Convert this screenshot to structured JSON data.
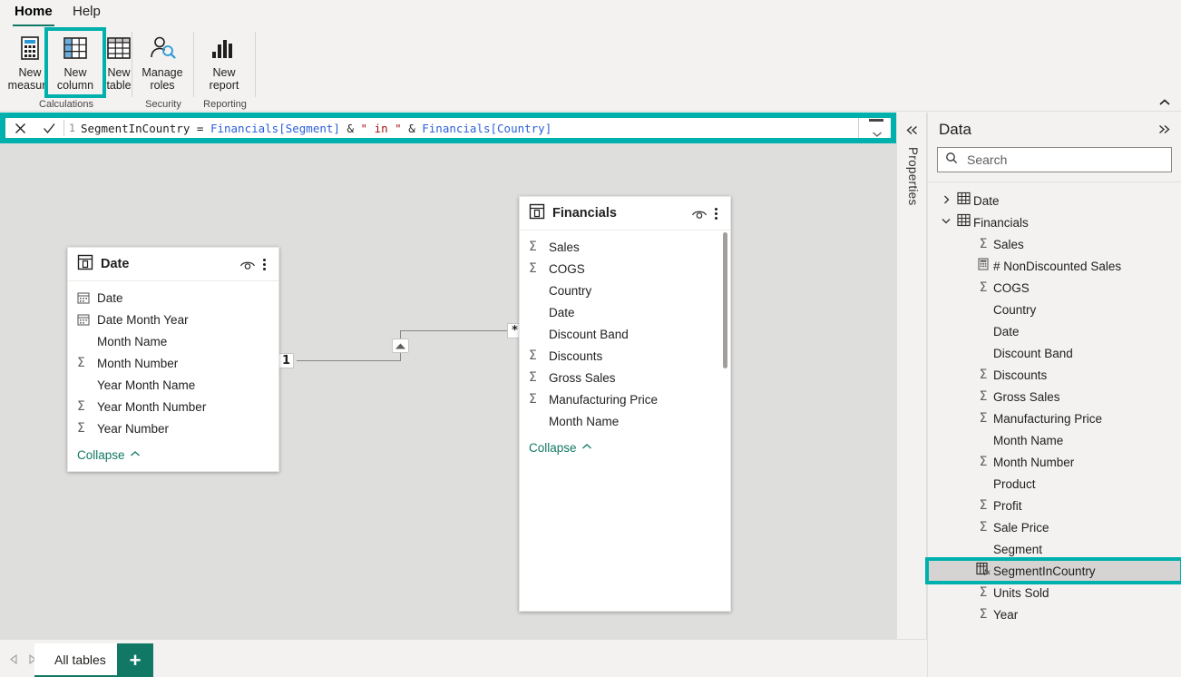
{
  "ribbon": {
    "tabs": [
      {
        "label": "Home",
        "active": true
      },
      {
        "label": "Help",
        "active": false
      }
    ],
    "groups": [
      {
        "label": "Calculations"
      },
      {
        "label": "Security"
      },
      {
        "label": "Reporting"
      }
    ],
    "buttons": [
      {
        "line1": "New",
        "line2": "measure",
        "icon": "new-measure-icon",
        "selected": false
      },
      {
        "line1": "New",
        "line2": "column",
        "icon": "new-column-icon",
        "selected": true
      },
      {
        "line1": "New",
        "line2": "table",
        "icon": "new-table-icon",
        "selected": false
      },
      {
        "line1": "Manage",
        "line2": "roles",
        "icon": "manage-roles-icon",
        "selected": false
      },
      {
        "line1": "New",
        "line2": "report",
        "icon": "new-report-icon",
        "selected": false
      }
    ],
    "collapse_icon": "chevron-up-icon"
  },
  "formula_bar": {
    "cancel_icon": "close-icon",
    "commit_icon": "checkmark-icon",
    "line_number": "1",
    "expression": "SegmentInCountry = Financials[Segment] & \" in \" & Financials[Country]",
    "tokens": {
      "name": "SegmentInCountry ",
      "equals": "= ",
      "ref1": "Financials[Segment]",
      "amp1": " & ",
      "string": "\" in \"",
      "amp2": " & ",
      "ref2": "Financials[Country]"
    },
    "expand_icon": "chevron-down-icon",
    "accent_color": "#00b0ad"
  },
  "properties_rail": {
    "label": "Properties",
    "collapse_icon": "chevron-double-left-icon"
  },
  "canvas": {
    "tables": [
      {
        "name": "Date",
        "icon": "table-card-icon",
        "eye_icon": "hide-eye-icon",
        "more_icon": "more-options-icon",
        "collapse_label": "Collapse",
        "collapse_icon": "chevron-up-icon",
        "fields": [
          {
            "name": "Date",
            "icon": "calendar-icon"
          },
          {
            "name": "Date Month Year",
            "icon": "calendar-icon"
          },
          {
            "name": "Month Name",
            "icon": "none"
          },
          {
            "name": "Month Number",
            "icon": "sigma-icon"
          },
          {
            "name": "Year Month Name",
            "icon": "none"
          },
          {
            "name": "Year Month Number",
            "icon": "sigma-icon"
          },
          {
            "name": "Year Number",
            "icon": "sigma-icon"
          }
        ]
      },
      {
        "name": "Financials",
        "icon": "table-card-icon",
        "eye_icon": "hide-eye-icon",
        "more_icon": "more-options-icon",
        "collapse_label": "Collapse",
        "collapse_icon": "chevron-up-icon",
        "fields": [
          {
            "name": "Sales",
            "icon": "sigma-icon"
          },
          {
            "name": "COGS",
            "icon": "sigma-icon"
          },
          {
            "name": "Country",
            "icon": "none"
          },
          {
            "name": "Date",
            "icon": "none"
          },
          {
            "name": "Discount Band",
            "icon": "none"
          },
          {
            "name": "Discounts",
            "icon": "sigma-icon"
          },
          {
            "name": "Gross Sales",
            "icon": "sigma-icon"
          },
          {
            "name": "Manufacturing Price",
            "icon": "sigma-icon"
          },
          {
            "name": "Month Name",
            "icon": "none"
          }
        ]
      }
    ],
    "relationship": {
      "from_cardinality": "1",
      "to_cardinality": "*",
      "direction_icon": "cross-filter-arrow-icon"
    }
  },
  "data_pane": {
    "title": "Data",
    "expand_icon": "chevron-double-right-icon",
    "search": {
      "placeholder": "Search",
      "value": "",
      "icon": "search-icon"
    },
    "items": [
      {
        "label": "Date",
        "level": 0,
        "chevron": "chevron-right-icon",
        "icon": "table-icon",
        "highlight": false
      },
      {
        "label": "Financials",
        "level": 0,
        "chevron": "chevron-down-icon",
        "icon": "table-icon",
        "highlight": false
      },
      {
        "label": "Sales",
        "level": 1,
        "chevron": "",
        "icon": "sigma-icon",
        "highlight": false
      },
      {
        "label": "# NonDiscounted Sales",
        "level": 1,
        "chevron": "",
        "icon": "measure-icon",
        "highlight": false
      },
      {
        "label": "COGS",
        "level": 1,
        "chevron": "",
        "icon": "sigma-icon",
        "highlight": false
      },
      {
        "label": "Country",
        "level": 1,
        "chevron": "",
        "icon": "none",
        "highlight": false
      },
      {
        "label": "Date",
        "level": 1,
        "chevron": "",
        "icon": "none",
        "highlight": false
      },
      {
        "label": "Discount Band",
        "level": 1,
        "chevron": "",
        "icon": "none",
        "highlight": false
      },
      {
        "label": "Discounts",
        "level": 1,
        "chevron": "",
        "icon": "sigma-icon",
        "highlight": false
      },
      {
        "label": "Gross Sales",
        "level": 1,
        "chevron": "",
        "icon": "sigma-icon",
        "highlight": false
      },
      {
        "label": "Manufacturing Price",
        "level": 1,
        "chevron": "",
        "icon": "sigma-icon",
        "highlight": false
      },
      {
        "label": "Month Name",
        "level": 1,
        "chevron": "",
        "icon": "none",
        "highlight": false
      },
      {
        "label": "Month Number",
        "level": 1,
        "chevron": "",
        "icon": "sigma-icon",
        "highlight": false
      },
      {
        "label": "Product",
        "level": 1,
        "chevron": "",
        "icon": "none",
        "highlight": false
      },
      {
        "label": "Profit",
        "level": 1,
        "chevron": "",
        "icon": "sigma-icon",
        "highlight": false
      },
      {
        "label": "Sale Price",
        "level": 1,
        "chevron": "",
        "icon": "sigma-icon",
        "highlight": false
      },
      {
        "label": "Segment",
        "level": 1,
        "chevron": "",
        "icon": "none",
        "highlight": false
      },
      {
        "label": "SegmentInCountry",
        "level": 1,
        "chevron": "",
        "icon": "calculated-column-icon",
        "highlight": true
      },
      {
        "label": "Units Sold",
        "level": 1,
        "chevron": "",
        "icon": "sigma-icon",
        "highlight": false
      },
      {
        "label": "Year",
        "level": 1,
        "chevron": "",
        "icon": "sigma-icon",
        "highlight": false
      }
    ]
  },
  "tab_bar": {
    "prev_icon": "triangle-left-icon",
    "next_icon": "triangle-right-icon",
    "tabs": [
      {
        "label": "All tables",
        "active": true
      }
    ],
    "add_label": "+",
    "add_icon": "plus-icon"
  },
  "colors": {
    "accent_teal": "#00b0ad",
    "brand_green": "#117865",
    "canvas_bg": "#dededd",
    "chrome_bg": "#f3f2f1"
  }
}
